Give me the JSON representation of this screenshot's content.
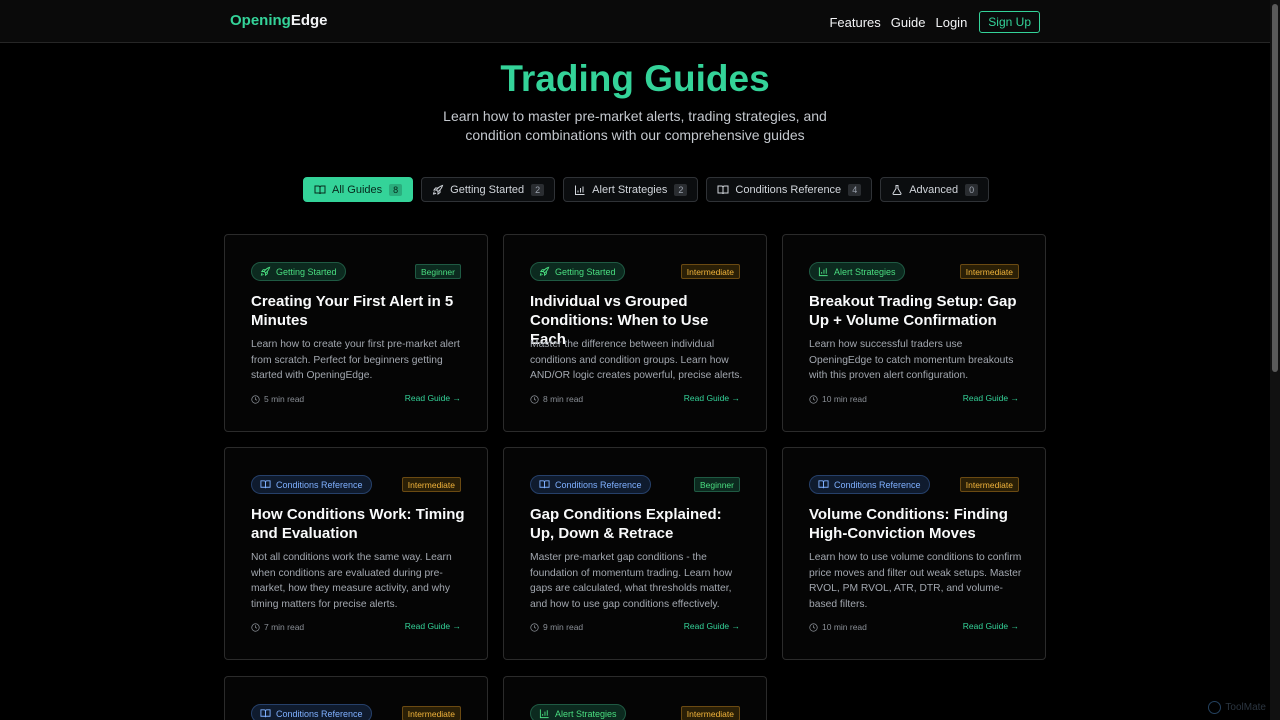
{
  "brand": {
    "part1": "Opening",
    "part2": "Edge"
  },
  "nav": {
    "features": "Features",
    "guide": "Guide",
    "login": "Login",
    "signup": "Sign Up"
  },
  "hero": {
    "title": "Trading Guides",
    "subtitle": "Learn how to master pre-market alerts, trading strategies, and condition combinations with our comprehensive guides"
  },
  "tabs": [
    {
      "label": "All Guides",
      "count": "8",
      "icon": "book-icon"
    },
    {
      "label": "Getting Started",
      "count": "2",
      "icon": "rocket-icon"
    },
    {
      "label": "Alert Strategies",
      "count": "2",
      "icon": "bar-chart-icon"
    },
    {
      "label": "Conditions Reference",
      "count": "4",
      "icon": "book-icon"
    },
    {
      "label": "Advanced",
      "count": "0",
      "icon": "flask-icon"
    }
  ],
  "cards": [
    {
      "category": "Getting Started",
      "level": "Beginner",
      "title": "Creating Your First Alert in 5 Minutes",
      "desc": "Learn how to create your first pre-market alert from scratch. Perfect for beginners getting started with OpeningEdge.",
      "time": "5 min read",
      "read": "Read Guide →"
    },
    {
      "category": "Getting Started",
      "level": "Intermediate",
      "title": "Individual vs Grouped Conditions: When to Use Each",
      "desc": "Master the difference between individual conditions and condition groups. Learn how AND/OR logic creates powerful, precise alerts.",
      "time": "8 min read",
      "read": "Read Guide →"
    },
    {
      "category": "Alert Strategies",
      "level": "Intermediate",
      "title": "Breakout Trading Setup: Gap Up + Volume Confirmation",
      "desc": "Learn how successful traders use OpeningEdge to catch momentum breakouts with this proven alert configuration.",
      "time": "10 min read",
      "read": "Read Guide →"
    },
    {
      "category": "Conditions Reference",
      "level": "Intermediate",
      "title": "How Conditions Work: Timing and Evaluation",
      "desc": "Not all conditions work the same way. Learn when conditions are evaluated during pre-market, how they measure activity, and why timing matters for precise alerts.",
      "time": "7 min read",
      "read": "Read Guide →"
    },
    {
      "category": "Conditions Reference",
      "level": "Beginner",
      "title": "Gap Conditions Explained: Up, Down & Retrace",
      "desc": "Master pre-market gap conditions - the foundation of momentum trading. Learn how gaps are calculated, what thresholds matter, and how to use gap conditions effectively.",
      "time": "9 min read",
      "read": "Read Guide →"
    },
    {
      "category": "Conditions Reference",
      "level": "Intermediate",
      "title": "Volume Conditions: Finding High-Conviction Moves",
      "desc": "Learn how to use volume conditions to confirm price moves and filter out weak setups. Master RVOL, PM RVOL, ATR, DTR, and volume-based filters.",
      "time": "10 min read",
      "read": "Read Guide →"
    },
    {
      "category": "Conditions Reference",
      "level": "Intermediate"
    },
    {
      "category": "Alert Strategies",
      "level": "Intermediate"
    }
  ],
  "watermark": "ToolMate",
  "colors": {
    "accent": "#34d399",
    "background": "#000000",
    "intermediate": "#f2b43b",
    "info": "#7fb0ff"
  }
}
